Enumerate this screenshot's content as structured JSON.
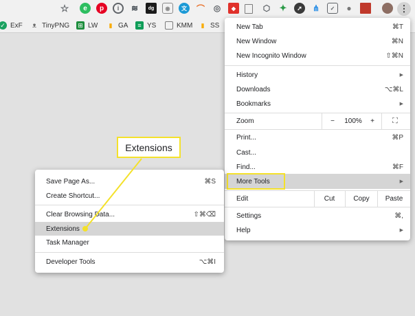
{
  "toolbar": {
    "extensions": [
      {
        "icon": "star-icon",
        "color": "#5f6368"
      },
      {
        "icon": "evernote-icon",
        "color": "#2dbe60"
      },
      {
        "icon": "pinterest-icon",
        "color": "#e60023"
      },
      {
        "icon": "info-icon",
        "color": "#5f6368"
      },
      {
        "icon": "buffer-icon",
        "color": "#323b43"
      },
      {
        "icon": "digg-icon",
        "color": "#1b1b1b"
      },
      {
        "icon": "camera-icon",
        "color": "#8a8a8a"
      },
      {
        "icon": "translate-icon",
        "color": "#1c9ad6"
      },
      {
        "icon": "rainbow-icon",
        "color": "#e8742f"
      },
      {
        "icon": "eye-icon",
        "color": "#5f6368"
      },
      {
        "icon": "tag-icon",
        "color": "#e0312b"
      },
      {
        "icon": "document-icon",
        "color": "#7c7c7c"
      },
      {
        "icon": "cube-icon",
        "color": "#5f6368"
      },
      {
        "icon": "reader-icon",
        "color": "#2b9a47"
      },
      {
        "icon": "compass-icon",
        "color": "#3a3a3a"
      },
      {
        "icon": "paint-icon",
        "color": "#1e88e5"
      },
      {
        "icon": "pocket-icon",
        "color": "#5f6368"
      },
      {
        "icon": "bulb-icon",
        "color": "#777777"
      },
      {
        "icon": "block-icon",
        "color": "#c0392b"
      },
      {
        "icon": "avatar-icon",
        "color": "#8d6e63"
      },
      {
        "icon": "kebab-menu-icon",
        "color": "#5f6368"
      }
    ]
  },
  "bookmarks": [
    {
      "label": "ExF",
      "icon": "bookmark-exf-icon",
      "color": "#1aa260"
    },
    {
      "label": "TinyPNG",
      "icon": "bookmark-tinypng-icon",
      "color": "#6a6a6a"
    },
    {
      "label": "LW",
      "icon": "bookmark-lw-icon",
      "color": "#1e8e3e"
    },
    {
      "label": "GA",
      "icon": "bookmark-ga-icon",
      "color": "#f9ab00"
    },
    {
      "label": "YS",
      "icon": "bookmark-ys-icon",
      "color": "#0f9d58"
    },
    {
      "label": "KMM",
      "icon": "bookmark-kmm-icon",
      "color": "#7b7b7b"
    },
    {
      "label": "SS",
      "icon": "bookmark-ss-icon",
      "color": "#f9ab00"
    }
  ],
  "main_menu": {
    "new_tab": {
      "label": "New Tab",
      "shortcut": "⌘T"
    },
    "new_window": {
      "label": "New Window",
      "shortcut": "⌘N"
    },
    "new_incognito": {
      "label": "New Incognito Window",
      "shortcut": "⇧⌘N"
    },
    "history": {
      "label": "History"
    },
    "downloads": {
      "label": "Downloads",
      "shortcut": "⌥⌘L"
    },
    "bookmarks": {
      "label": "Bookmarks"
    },
    "zoom": {
      "label": "Zoom",
      "minus": "−",
      "value": "100%",
      "plus": "+"
    },
    "print": {
      "label": "Print...",
      "shortcut": "⌘P"
    },
    "cast": {
      "label": "Cast..."
    },
    "find": {
      "label": "Find...",
      "shortcut": "⌘F"
    },
    "more_tools": {
      "label": "More Tools"
    },
    "edit": {
      "label": "Edit",
      "cut": "Cut",
      "copy": "Copy",
      "paste": "Paste"
    },
    "settings": {
      "label": "Settings",
      "shortcut": "⌘,"
    },
    "help": {
      "label": "Help"
    }
  },
  "submenu": {
    "save_page": {
      "label": "Save Page As...",
      "shortcut": "⌘S"
    },
    "create_shortcut": {
      "label": "Create Shortcut..."
    },
    "clear_browsing": {
      "label": "Clear Browsing Data...",
      "shortcut": "⇧⌘⌫"
    },
    "extensions": {
      "label": "Extensions"
    },
    "task_manager": {
      "label": "Task Manager"
    },
    "developer_tools": {
      "label": "Developer Tools",
      "shortcut": "⌥⌘I"
    }
  },
  "callout": {
    "label": "Extensions",
    "color": "#f4e12a"
  }
}
